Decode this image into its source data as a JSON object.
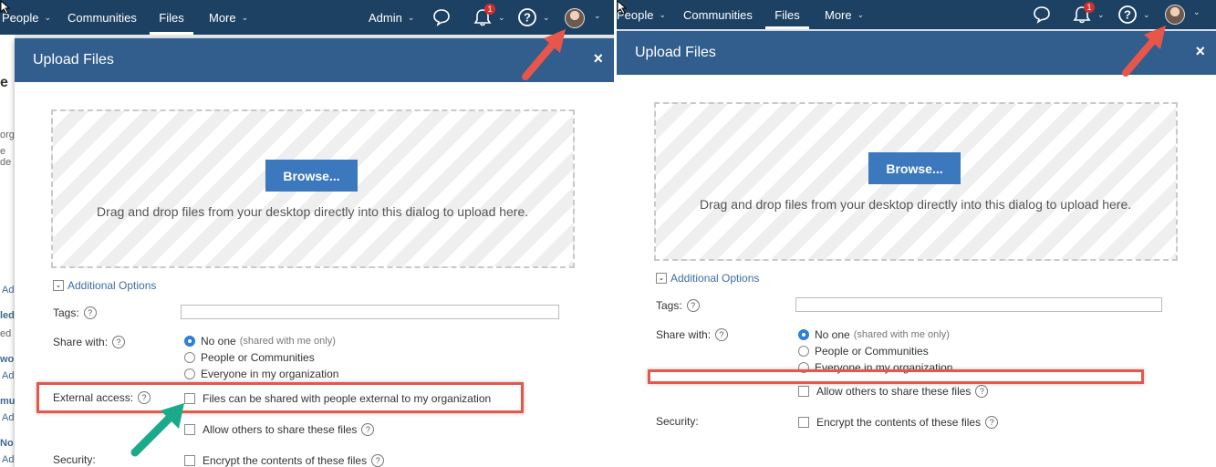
{
  "left": {
    "nav": {
      "items": [
        "People",
        "Communities",
        "Files",
        "More"
      ],
      "active": "Files",
      "admin_label": "Admin",
      "notification_count": "1"
    },
    "background_texts": [
      "e",
      "org",
      "e de",
      "Ad",
      "led",
      "ed",
      "wo",
      "Ad",
      "mu",
      "Ad",
      "No",
      "Ad"
    ],
    "dialog": {
      "title": "Upload Files",
      "close_label": "×",
      "browse_label": "Browse...",
      "drop_text": "Drag and drop files from your desktop directly into this dialog to upload here.",
      "additional_options_label": "Additional Options",
      "tags_label": "Tags:",
      "share_with_label": "Share with:",
      "share_options": [
        {
          "label": "No one",
          "hint": "(shared with me only)"
        },
        {
          "label": "People or Communities",
          "hint": ""
        },
        {
          "label": "Everyone in my organization",
          "hint": ""
        }
      ],
      "external_access_label": "External access:",
      "external_access_option": "Files can be shared with people external to my organization",
      "allow_share_option": "Allow others to share these files",
      "security_label": "Security:",
      "encrypt_option": "Encrypt the contents of these files"
    }
  },
  "right": {
    "nav": {
      "items": [
        "People",
        "Communities",
        "Files",
        "More"
      ],
      "active": "Files",
      "notification_count": "1"
    },
    "dialog": {
      "title": "Upload Files",
      "close_label": "×",
      "browse_label": "Browse...",
      "drop_text": "Drag and drop files from your desktop directly into this dialog to upload here.",
      "additional_options_label": "Additional Options",
      "tags_label": "Tags:",
      "share_with_label": "Share with:",
      "share_options": [
        {
          "label": "No one",
          "hint": "(shared with me only)"
        },
        {
          "label": "People or Communities",
          "hint": ""
        },
        {
          "label": "Everyone in my organization",
          "hint": ""
        }
      ],
      "allow_share_option": "Allow others to share these files",
      "security_label": "Security:",
      "encrypt_option": "Encrypt the contents of these files"
    }
  },
  "colors": {
    "nav_bg": "#1d4163",
    "dialog_header": "#315e8d",
    "browse_button": "#3b78be",
    "highlight_box": "#e8564b",
    "arrow_red": "#e8564b",
    "arrow_teal": "#1aaa8a"
  }
}
